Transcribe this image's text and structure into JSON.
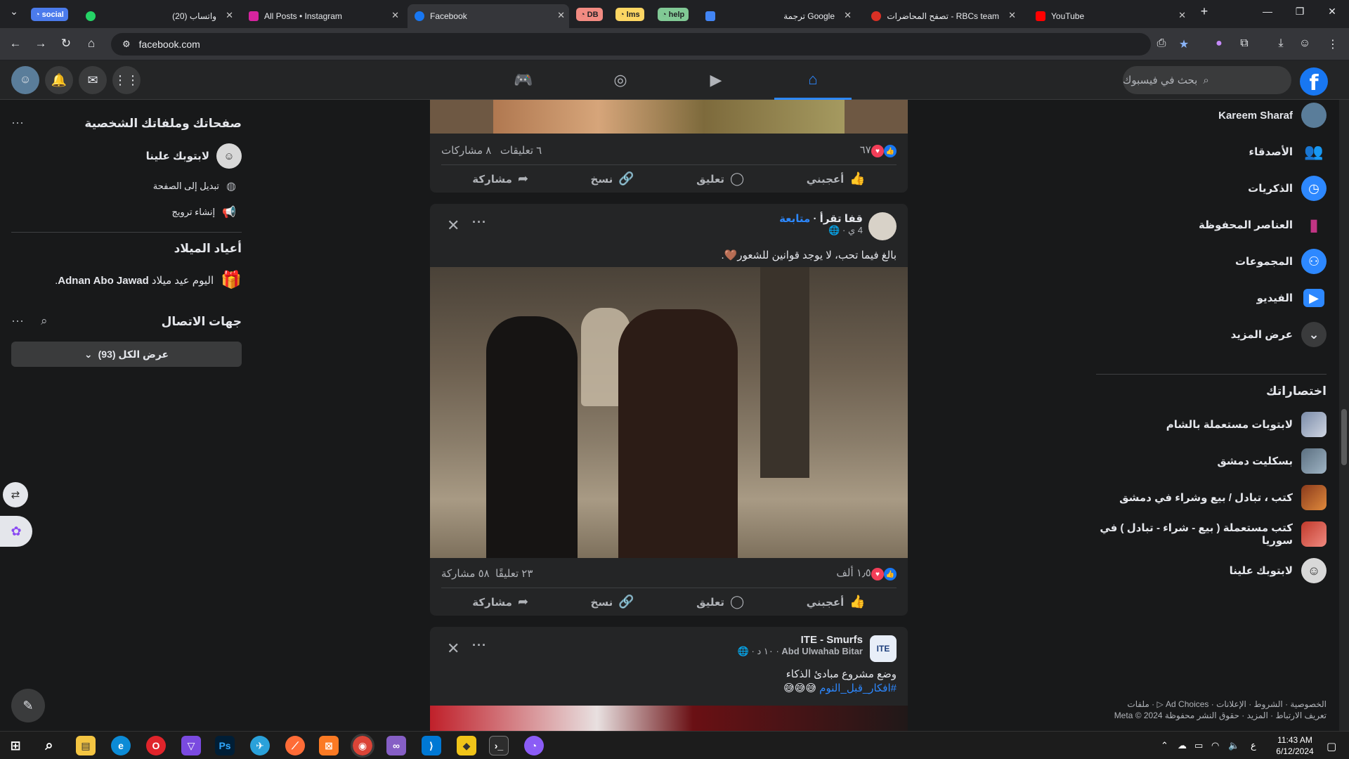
{
  "browser": {
    "tabs": [
      {
        "label": "(20) واتساب"
      },
      {
        "label": "All Posts • Instagram"
      },
      {
        "label": "Facebook"
      },
      {
        "label": "ترجمة Google"
      },
      {
        "label": "تصفح المحاضرات - RBCs team"
      },
      {
        "label": "YouTube"
      }
    ],
    "groups": [
      {
        "label": "social",
        "color": "#4b7bec"
      },
      {
        "label": "DB",
        "color": "#f28b82"
      },
      {
        "label": "lms",
        "color": "#fdd663"
      },
      {
        "label": "help",
        "color": "#81c995"
      }
    ],
    "url": "facebook.com",
    "new_tab": "+",
    "close_glyph": "✕"
  },
  "fb": {
    "search_placeholder": "بحث في فيسبوك",
    "logo": "f",
    "right_sidebar": {
      "profile_name": "Kareem Sharaf",
      "items": [
        {
          "label": "الأصدقاء",
          "icon": "friends-icon"
        },
        {
          "label": "الذكريات",
          "icon": "clock-icon"
        },
        {
          "label": "العناصر المحفوظة",
          "icon": "bookmark-icon"
        },
        {
          "label": "المجموعات",
          "icon": "groups-icon"
        },
        {
          "label": "الفيديو",
          "icon": "video-icon"
        },
        {
          "label": "عرض المزيد",
          "icon": "chevron-down-icon"
        }
      ],
      "shortcuts_title": "اختصاراتك",
      "shortcuts": [
        {
          "label": "لابتوبات مستعملة بالشام"
        },
        {
          "label": "بسكليت دمشق"
        },
        {
          "label": "كتب ، تبادل / بيع وشراء في دمشق"
        },
        {
          "label": "كتب مستعملة ( بيع - شراء - تبادل ) في سوريا"
        },
        {
          "label": "لابتوبك علينا"
        }
      ],
      "footer_line1": "الخصوصية · الشروط · الإعلانات · Ad Choices ▷ · ملفات",
      "footer_line2": "تعريف الارتباط · المزيد · حقوق النشر محفوظة Meta © 2024"
    },
    "left_sidebar": {
      "pages_title": "صفحاتك وملفاتك الشخصية",
      "page_name": "لابتوبك علينا",
      "switch_label": "تبديل إلى الصفحة",
      "promote_label": "إنشاء ترويج",
      "birthdays_title": "أعياد الميلاد",
      "birthday_text_prefix": "اليوم عيد ميلاد ",
      "birthday_name": "Adnan Abo Jawad",
      "contacts_title": "جهات الاتصال",
      "show_all": "عرض الكل (93)"
    },
    "posts": [
      {
        "reactions": "٦٧",
        "comments": "٦ تعليقات",
        "shares": "٨ مشاركات"
      },
      {
        "author": "قفا تقرأ",
        "follow": "متابعة",
        "time": "4 ي",
        "text": "بالغ فيما تحب، لا يوجد قوانين للشعور🤎.",
        "reactions": "١٫٥ ألف",
        "comments": "٢٣ تعليقًا",
        "shares": "٥٨ مشاركة"
      },
      {
        "author": "ITE - Smurfs",
        "subauthor": "Abd Ulwahab Bitar",
        "time": "١٠ د",
        "text": "وضع مشروع مبادئ الذكاء",
        "hashtag": "#افكار_قبل_النوم",
        "emoji": "😅😅😅"
      }
    ],
    "actions": {
      "like": "أعجبني",
      "comment": "تعليق",
      "copy": "نسخ",
      "share": "مشاركة"
    }
  },
  "taskbar": {
    "time": "11:43 AM",
    "date": "6/12/2024",
    "lang": "ع"
  }
}
